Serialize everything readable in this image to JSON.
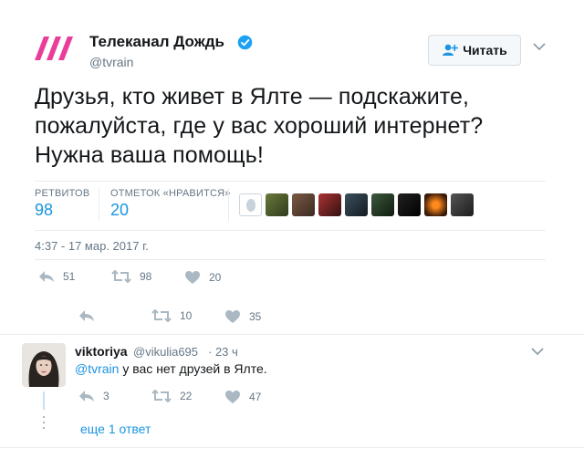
{
  "account": {
    "name": "Телеканал Дождь",
    "handle": "@tvrain",
    "follow_label": "Читать"
  },
  "tweet": {
    "lines": [
      "Друзья, кто живет в Ялте — подскажите,",
      "пожалуйста, где у вас хороший интернет?",
      "Нужна ваша помощь!"
    ],
    "retweets_label": "РЕТВИТОВ",
    "retweets": "98",
    "likes_label": "ОТМЕТОК «НРАВИТСЯ»",
    "likes": "20",
    "timestamp": "4:37 - 17 мар. 2017 г.",
    "actions": {
      "replies": "51",
      "retweets": "98",
      "likes": "20"
    },
    "actions2": {
      "retweets": "10",
      "likes": "35"
    }
  },
  "reply": {
    "name": "viktoriya",
    "handle": "@vikulia695",
    "time": "· 23 ч",
    "mention": "@tvrain",
    "text": " у вас нет друзей в Ялте.",
    "actions": {
      "replies": "3",
      "retweets": "22",
      "likes": "47"
    },
    "more_replies": "еще 1 ответ"
  },
  "colors": {
    "brand": "#ea3d9a",
    "link": "#1b95e0",
    "muted": "#657786",
    "verified": "#1da1f2"
  },
  "icons": [
    "dozhd-logo-icon",
    "verified-badge-icon",
    "add-user-icon",
    "chevron-down-icon",
    "reply-icon",
    "retweet-icon",
    "heart-icon"
  ]
}
